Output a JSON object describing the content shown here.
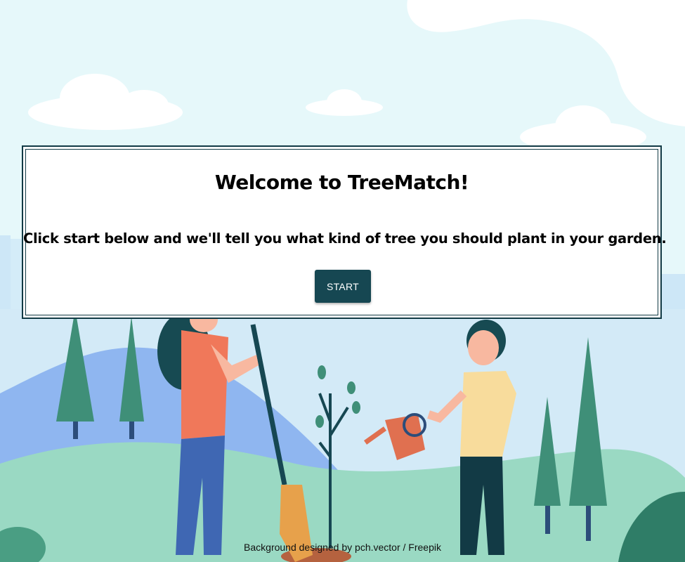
{
  "app": {
    "name": "TreeMatch"
  },
  "welcome": {
    "title": "Welcome to TreeMatch!",
    "subtitle": "Click start below and we'll tell you what kind of tree you should plant in your garden.",
    "start_label": "START"
  },
  "footer": {
    "credit": "Background designed by pch.vector / Freepik"
  },
  "colors": {
    "sky": "#e6f8fa",
    "button": "#164752",
    "card_border": "#123a45",
    "hill_back": "#8fb6f0",
    "hill_front": "#9ad9c3",
    "tree": "#3f8f78"
  },
  "icons": {
    "background": "tree-planting-illustration"
  }
}
